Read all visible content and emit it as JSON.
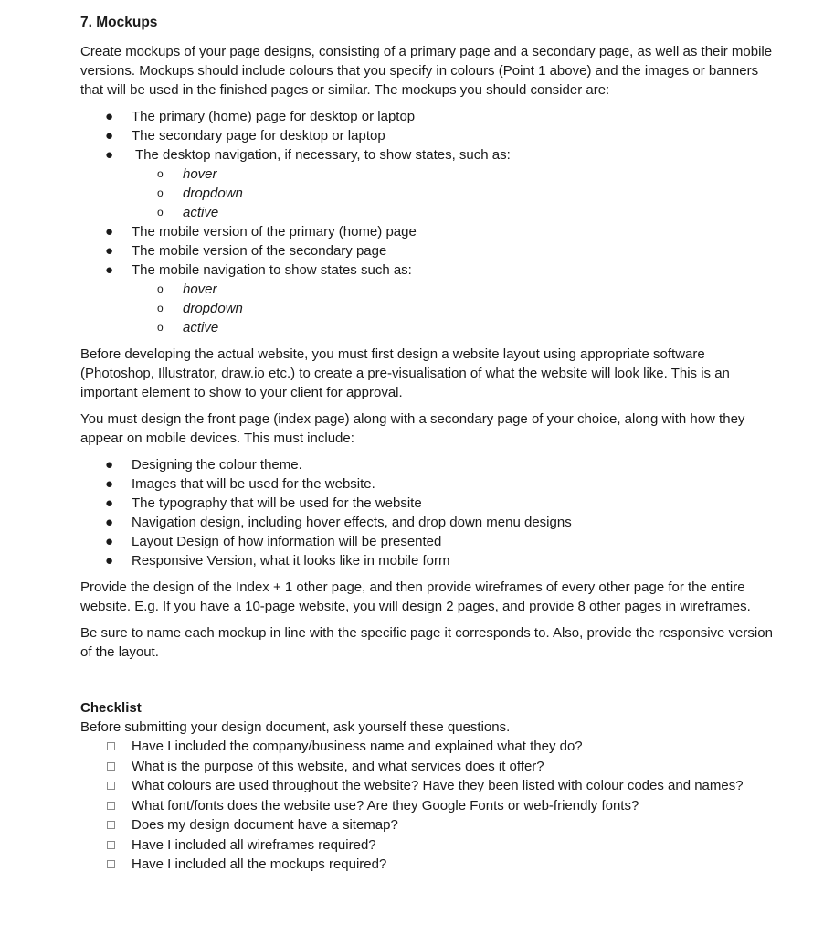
{
  "section": {
    "title": "7. Mockups",
    "intro": "Create mockups of your page designs, consisting of a primary page and a secondary page, as well as their mobile versions. Mockups should include colours that you specify in colours (Point 1 above) and the images or banners that will be used in the finished pages or similar. The mockups you should consider are:",
    "mockup_list": [
      {
        "text": "The primary (home) page for desktop or laptop",
        "sub": []
      },
      {
        "text": "The secondary page for desktop or laptop",
        "sub": []
      },
      {
        "text": "The desktop navigation, if necessary, to show states, such as:",
        "sub": [
          "hover",
          "dropdown",
          "active"
        ]
      },
      {
        "text": "The mobile version of the primary (home) page",
        "sub": []
      },
      {
        "text": "The mobile version of the secondary page",
        "sub": []
      },
      {
        "text": "The mobile navigation to show states such as:",
        "sub": [
          "hover",
          "dropdown",
          "active"
        ]
      }
    ],
    "para_before": "Before developing the actual website, you must first design a website layout using appropriate software (Photoshop, Illustrator, draw.io etc.) to create a pre-visualisation of what the website will look like. This is an important element to show to your client for approval.",
    "para_front": "You must design the front page (index page) along with a secondary page of your choice, along with how they appear on mobile devices. This must include:",
    "include_list": [
      "Designing the colour theme.",
      "Images that will be used for the website.",
      "The typography that will be used for the website",
      "Navigation design, including hover effects, and drop down menu designs",
      "Layout Design of how information will be presented",
      "Responsive Version, what it looks like in mobile form"
    ],
    "para_provide": "Provide the design of the Index + 1 other page, and then provide wireframes of every other page for the entire website. E.g. If you have a 10-page website, you will design 2 pages, and provide 8 other pages in wireframes.",
    "para_name": "Be sure to name each mockup in line with the specific page it corresponds to. Also, provide the responsive version of the layout."
  },
  "checklist": {
    "title": "Checklist",
    "intro": "Before submitting your design document, ask yourself these questions.",
    "items": [
      {
        "text": "Have I included the company/business name and explained what they do?",
        "checked": false
      },
      {
        "text": "What is the purpose of this website, and what services does it offer?",
        "checked": false
      },
      {
        "text": "What colours are used throughout the website? Have they been listed with colour codes and names?",
        "checked": false
      },
      {
        "text": "What font/fonts does the website use? Are they Google Fonts or web-friendly fonts?",
        "checked": false
      },
      {
        "text": "Does my design document have a sitemap?",
        "checked": false
      },
      {
        "text": "Have I included all wireframes required?",
        "checked": false
      },
      {
        "text": "Have I included all the mockups required?",
        "checked": false
      }
    ]
  },
  "glyphs": {
    "bullet": "●",
    "sub_bullet": "o"
  }
}
